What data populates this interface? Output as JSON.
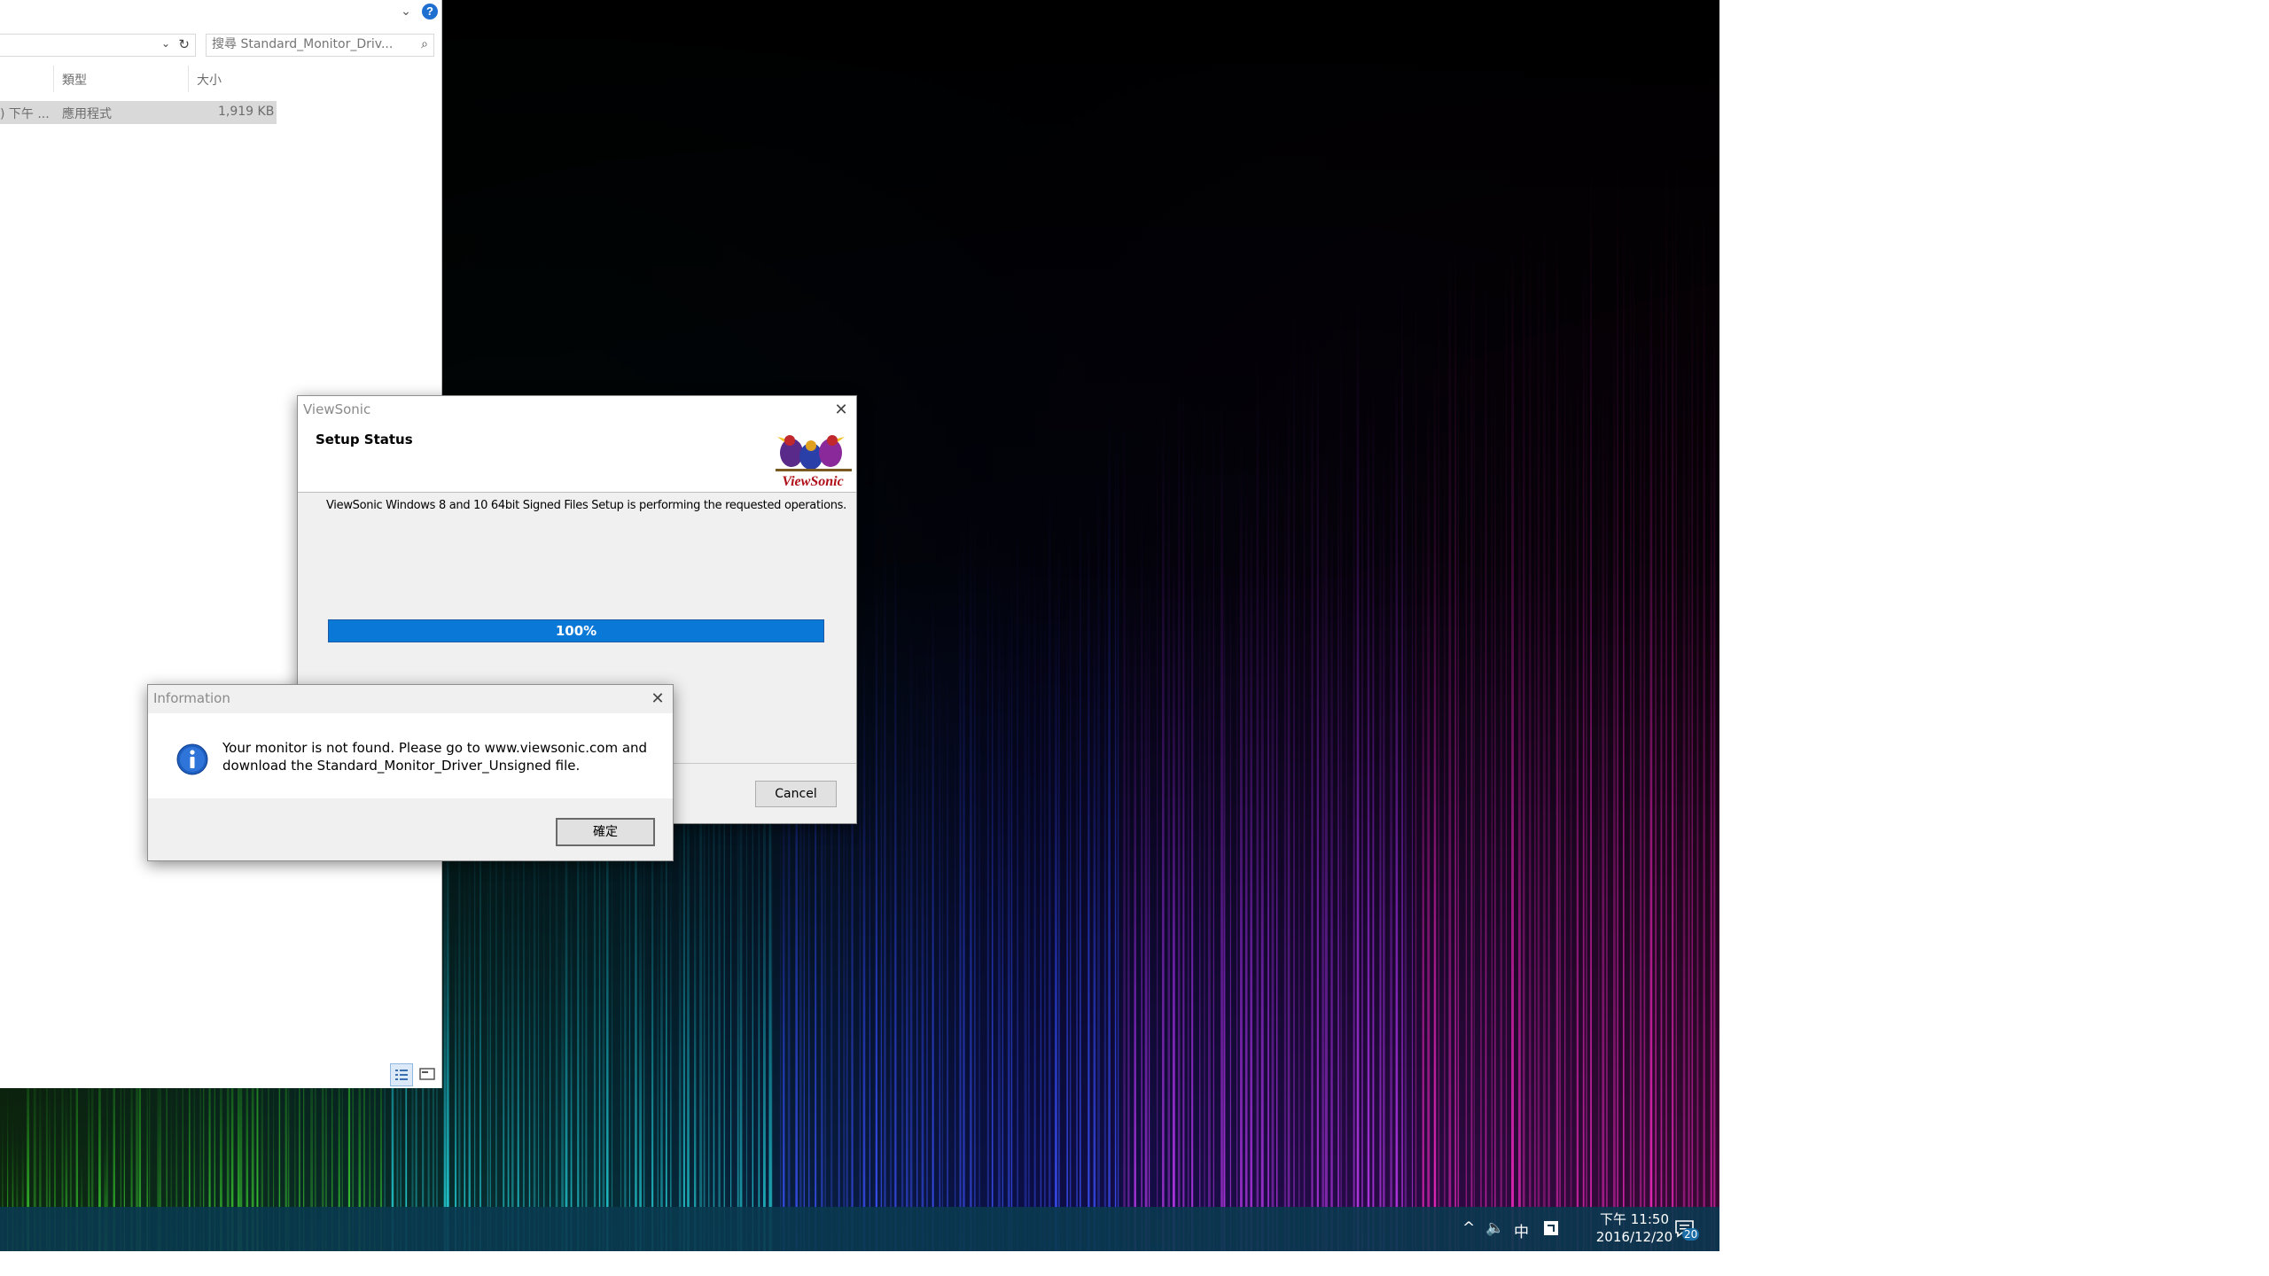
{
  "explorer": {
    "search_placeholder": "搜尋 Standard_Monitor_Driv...",
    "columns": {
      "type": "類型",
      "size": "大小"
    },
    "file_row": {
      "date_fragment": ") 下午 ...",
      "type": "應用程式",
      "size": "1,919 KB"
    },
    "help_glyph": "?"
  },
  "setup_dialog": {
    "title": "ViewSonic",
    "heading": "Setup Status",
    "logo_text": "ViewSonic",
    "message": "ViewSonic Windows 8 and 10 64bit Signed Files Setup is performing the requested operations.",
    "progress": 1.0,
    "progress_label": "100%",
    "cancel_label": "Cancel"
  },
  "info_dialog": {
    "title": "Information",
    "message_line1": "Your monitor is not found.  Please go to www.viewsonic.com and",
    "message_line2": "download the Standard_Monitor_Driver_Unsigned file.",
    "ok_label": "確定"
  },
  "taskbar": {
    "tray_chevron": "^",
    "volume_glyph": "🔈",
    "ime_label": "中",
    "time": "下午 11:50",
    "date": "2016/12/20",
    "notification_count": "20"
  },
  "colors": {
    "progress_blue": "#0a78d7",
    "taskbar": "#0a384e",
    "info_icon": "#1f5fbf"
  }
}
